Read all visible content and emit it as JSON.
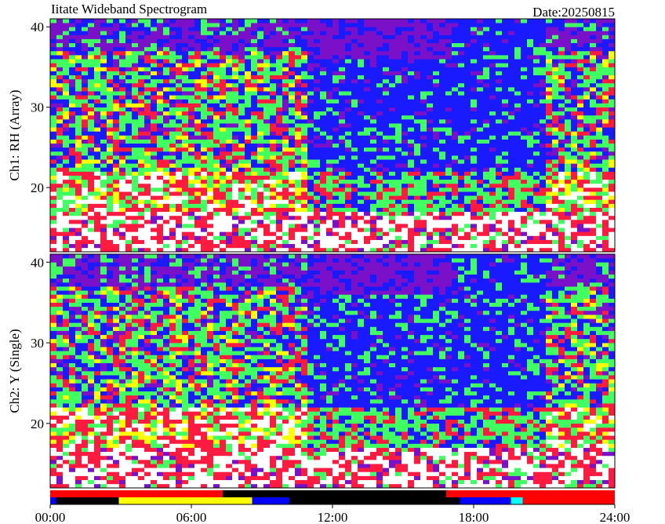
{
  "header": {
    "title": "Iitate Wideband Spectrogram",
    "date": "Date:20250815"
  },
  "colors": {
    "low": "#7a10c8",
    "blue": "#1a1aff",
    "green": "#40ff60",
    "red": "#ff1a40",
    "yellow": "#ffff00",
    "white": "#ffffff"
  },
  "chart_data": [
    {
      "type": "heatmap",
      "panel": "ch1",
      "ylabel": "Ch1: RH (Array)",
      "ylim": [
        12,
        41
      ],
      "yticks": [
        20,
        30,
        40
      ],
      "xlim": [
        "00:00",
        "24:00"
      ]
    },
    {
      "type": "heatmap",
      "panel": "ch2",
      "ylabel": "Ch2: Y (Single)",
      "ylim": [
        12,
        41
      ],
      "yticks": [
        20,
        30,
        40
      ],
      "xlim": [
        "00:00",
        "24:00"
      ],
      "xticks": [
        "00:00",
        "06:00",
        "12:00",
        "18:00",
        "24:00"
      ],
      "status_bars": {
        "top": [
          {
            "start": "00:00",
            "end": "07:20",
            "color": "#ff0000"
          },
          {
            "start": "07:20",
            "end": "16:50",
            "color": "#000000"
          },
          {
            "start": "16:50",
            "end": "24:00",
            "color": "#ff0000"
          }
        ],
        "bottom": [
          {
            "start": "00:00",
            "end": "00:15",
            "color": "#0000ff"
          },
          {
            "start": "00:15",
            "end": "02:55",
            "color": "#000000"
          },
          {
            "start": "02:55",
            "end": "08:35",
            "color": "#ffff00"
          },
          {
            "start": "08:35",
            "end": "10:10",
            "color": "#0000ff"
          },
          {
            "start": "10:10",
            "end": "17:25",
            "color": "#000000"
          },
          {
            "start": "17:25",
            "end": "19:35",
            "color": "#0000ff"
          },
          {
            "start": "19:35",
            "end": "20:05",
            "color": "#00ffff"
          },
          {
            "start": "20:05",
            "end": "24:00",
            "color": "#ff0000"
          }
        ]
      }
    }
  ]
}
